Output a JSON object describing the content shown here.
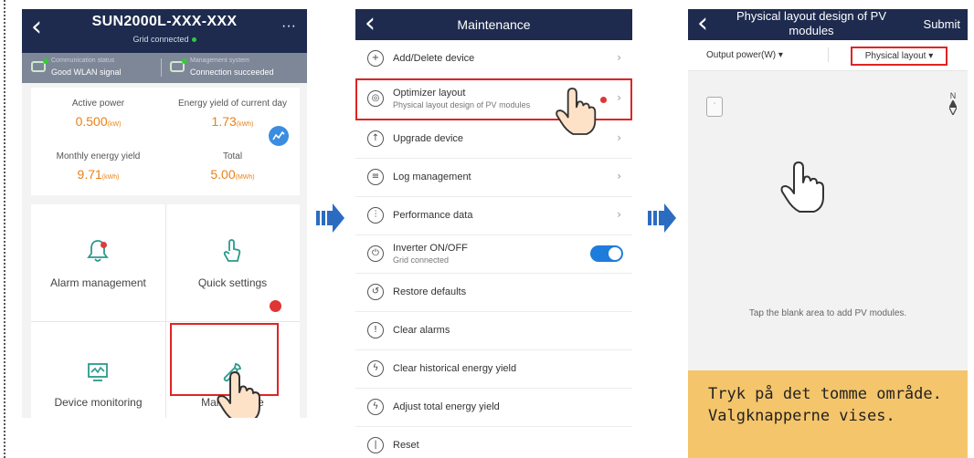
{
  "screen1": {
    "title": "SUN2000L-XXX-XXX",
    "subtitle": "Grid connected",
    "comm_label": "Communication status",
    "comm_value": "Good WLAN signal",
    "mgmt_label": "Management system",
    "mgmt_value": "Connection succeeded",
    "stats": [
      {
        "label": "Active power",
        "value": "0.500",
        "unit": "(kW)"
      },
      {
        "label": "Energy yield of current day",
        "value": "1.73",
        "unit": "(kWh)"
      },
      {
        "label": "Monthly energy yield",
        "value": "9.71",
        "unit": "(kWh)"
      },
      {
        "label": "Total",
        "value": "5.00",
        "unit": "(MWh)"
      }
    ],
    "tiles": [
      {
        "label": "Alarm management",
        "icon": "bell-icon"
      },
      {
        "label": "Quick settings",
        "icon": "hand-pointer-icon"
      },
      {
        "label": "Device monitoring",
        "icon": "monitor-icon"
      },
      {
        "label": "Maintenance",
        "icon": "wrench-icon"
      }
    ]
  },
  "screen2": {
    "title": "Maintenance",
    "items": [
      {
        "label": "Add/Delete device",
        "icon": "plus-circle-icon"
      },
      {
        "label": "Optimizer layout",
        "sub": "Physical layout design of PV modules",
        "icon": "optimizer-icon"
      },
      {
        "label": "Upgrade device",
        "icon": "upgrade-icon"
      },
      {
        "label": "Log management",
        "icon": "log-icon"
      },
      {
        "label": "Performance data",
        "icon": "performance-icon"
      },
      {
        "label": "Inverter ON/OFF",
        "sub": "Grid connected",
        "icon": "power-icon"
      },
      {
        "label": "Restore defaults",
        "icon": "restore-icon"
      },
      {
        "label": "Clear alarms",
        "icon": "clear-alarm-icon"
      },
      {
        "label": "Clear historical energy yield",
        "icon": "clear-yield-icon"
      },
      {
        "label": "Adjust total energy yield",
        "icon": "adjust-yield-icon"
      },
      {
        "label": "Reset",
        "icon": "reset-icon"
      }
    ],
    "toggle_on": true
  },
  "screen3": {
    "title": "Physical layout design of PV modules",
    "submit": "Submit",
    "option1": "Output power(W)",
    "option2": "Physical layout",
    "north": "N",
    "hint": "Tap the blank area to add PV modules.",
    "caption": "Tryk på det tomme område. Valgknapperne vises."
  },
  "colors": {
    "header": "#1e2b4f",
    "highlight": "#e02424",
    "caption_bg": "#f5c56b",
    "value_orange": "#e8811a",
    "toggle": "#1e7cdc",
    "arrow": "#2b6cc0"
  }
}
